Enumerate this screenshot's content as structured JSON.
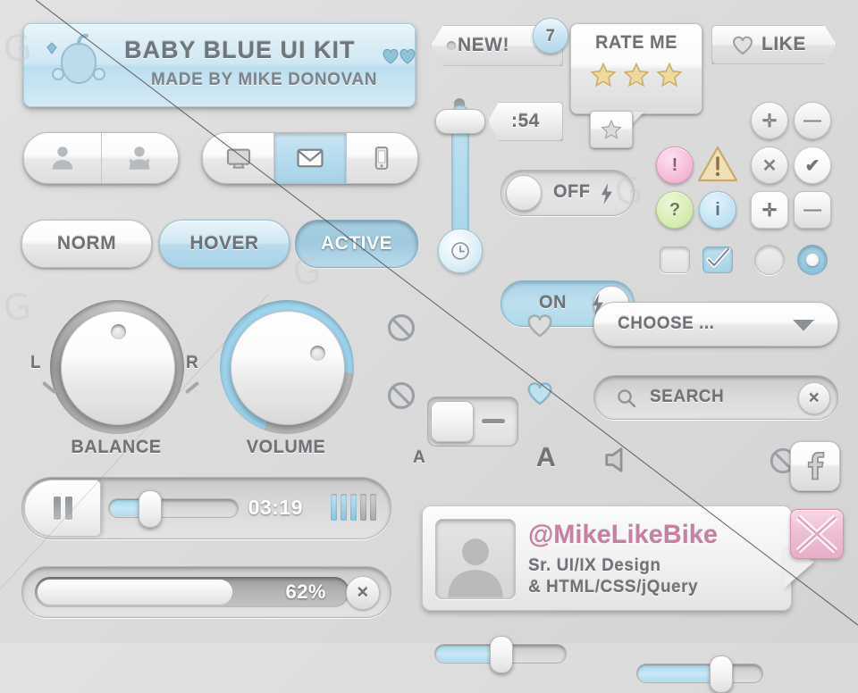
{
  "meta": {
    "kit_title": "BABY BLUE UI KIT",
    "kit_subtitle": "MADE BY MIKE DONOVAN",
    "background_color": "#dcdcdc",
    "accent_blue": "#a9d3e8",
    "accent_pink": "#c77fa3"
  },
  "banner": {
    "title": "BABY BLUE UI KIT",
    "subtitle": "MADE BY MIKE DONOVAN",
    "rattle_icon": "baby-rattle-icon",
    "heart_icon": "heart-icon"
  },
  "tags": {
    "new_label": "NEW!",
    "new_badge_count": "7",
    "time_label": ":54",
    "like_label": "LIKE",
    "like_icon": "heart-icon"
  },
  "rate_me": {
    "title": "RATE ME",
    "stars_filled": 3,
    "stars_total": 3,
    "star_icon": "star-icon",
    "star_color": "#e8c87a"
  },
  "segmented_users": {
    "items": [
      {
        "icon": "user-male-icon",
        "active": false
      },
      {
        "icon": "user-female-icon",
        "active": false
      }
    ]
  },
  "segmented_devices": {
    "items": [
      {
        "icon": "monitor-icon",
        "active": false
      },
      {
        "icon": "mail-icon",
        "active": true
      },
      {
        "icon": "phone-icon",
        "active": false
      }
    ]
  },
  "state_buttons": [
    {
      "label": "NORM",
      "state": "normal"
    },
    {
      "label": "HOVER",
      "state": "hover"
    },
    {
      "label": "ACTIVE",
      "state": "active"
    }
  ],
  "thermo_slider": {
    "value_percent": 92,
    "bulb_icon": "clock-icon"
  },
  "toggles": [
    {
      "label": "OFF",
      "state": "off",
      "icon": "lightning-bolt-icon"
    },
    {
      "label": "ON",
      "state": "on",
      "icon": "lightning-bolt-icon"
    }
  ],
  "icon_grid": {
    "row1": [
      {
        "name": "move-icon",
        "glyph": "✛",
        "style": "grey-circle"
      },
      {
        "name": "minus-icon",
        "glyph": "—",
        "style": "grey-circle"
      }
    ],
    "row2": [
      {
        "name": "alert-icon",
        "glyph": "!",
        "style": "pink-circle"
      },
      {
        "name": "warning-icon",
        "glyph": "!",
        "style": "yellow-triangle"
      },
      {
        "name": "close-icon",
        "glyph": "✕",
        "style": "grey-circle"
      },
      {
        "name": "check-icon",
        "glyph": "✔",
        "style": "white-circle"
      }
    ],
    "row3": [
      {
        "name": "help-icon",
        "glyph": "?",
        "style": "green-circle"
      },
      {
        "name": "info-icon",
        "glyph": "i",
        "style": "blue-circle"
      },
      {
        "name": "move-square-icon",
        "glyph": "✛",
        "style": "white-square"
      },
      {
        "name": "minus-square-icon",
        "glyph": "—",
        "style": "grey-square"
      }
    ],
    "row4": [
      {
        "name": "checkbox-unchecked",
        "checked": false
      },
      {
        "name": "checkbox-checked",
        "checked": true
      },
      {
        "name": "radio-unchecked",
        "checked": false
      },
      {
        "name": "radio-checked",
        "checked": true
      }
    ]
  },
  "knobs": [
    {
      "label": "BALANCE",
      "left_marker": "L",
      "right_marker": "R",
      "angle_deg": 0
    },
    {
      "label": "VOLUME",
      "angle_deg": 58,
      "arc_percent": 78
    }
  ],
  "ios_switches": [
    {
      "state": "off",
      "left_icon": "no-entry-icon",
      "right_icon": "heart-icon"
    },
    {
      "state": "on",
      "left_icon": "no-entry-icon",
      "right_icon": "heart-icon"
    }
  ],
  "dropdown": {
    "label": "CHOOSE ...",
    "chevron": "chevron-down-icon"
  },
  "search": {
    "value": "SEARCH",
    "placeholder": "SEARCH",
    "icon": "search-icon",
    "clear": "✕"
  },
  "h_sliders": [
    {
      "name": "text-size-slider",
      "left_icon": "small-a-icon",
      "left_label": "A",
      "right_icon": "large-a-icon",
      "right_label": "A",
      "value_percent": 52
    },
    {
      "name": "volume-slider",
      "left_icon": "speaker-icon",
      "right_icon": "mute-icon",
      "value_percent": 70
    }
  ],
  "media_player": {
    "button_icon": "pause-icon",
    "time": "03:19",
    "seek_percent": 30,
    "equalizer_bars": [
      true,
      true,
      true,
      false,
      false
    ]
  },
  "progress": {
    "percent_label": "62%",
    "percent": 62,
    "cancel": "✕"
  },
  "profile": {
    "handle": "@MikeLikeBike",
    "line1": "Sr. UI/IX Design",
    "line2": "& HTML/CSS/jQuery",
    "avatar_icon": "user-avatar-icon"
  },
  "social": {
    "facebook_icon": "facebook-icon",
    "gift_icon": "gift-box-icon"
  }
}
